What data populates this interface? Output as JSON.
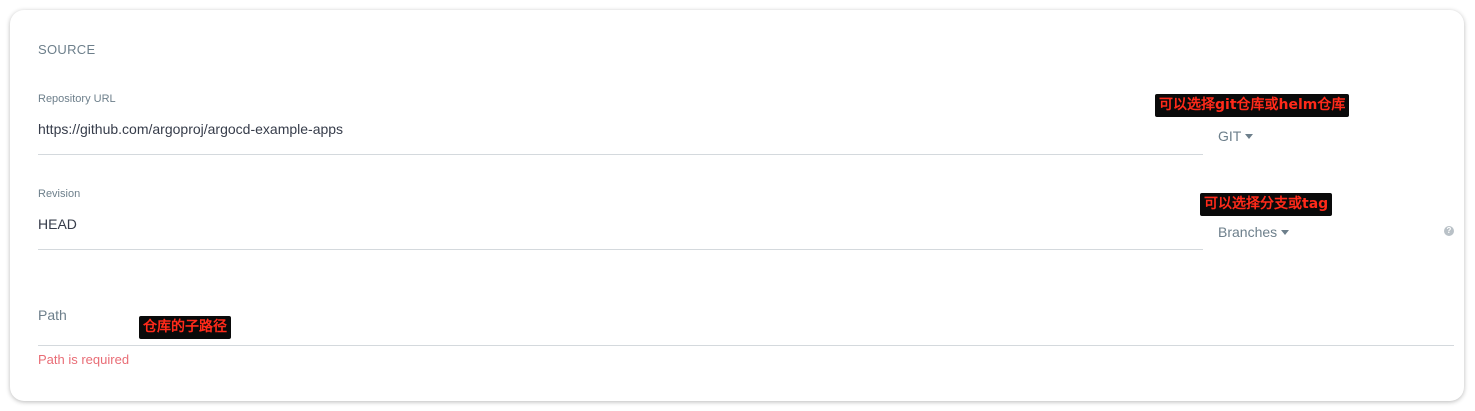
{
  "source": {
    "title": "SOURCE",
    "repository": {
      "label": "Repository URL",
      "value": "https://github.com/argoproj/argocd-example-apps",
      "type_dropdown": "GIT",
      "annotation": "可以选择git仓库或helm仓库"
    },
    "revision": {
      "label": "Revision",
      "value": "HEAD",
      "type_dropdown": "Branches",
      "annotation": "可以选择分支或tag",
      "help_icon": "question-icon"
    },
    "path": {
      "placeholder": "Path",
      "annotation": "仓库的子路径",
      "error": "Path is required"
    }
  },
  "colors": {
    "label": "#6d7f8b",
    "value": "#363c4a",
    "error": "#e96d76",
    "annotation_text": "#ff2a1a",
    "annotation_bg": "#0a0a0a"
  }
}
